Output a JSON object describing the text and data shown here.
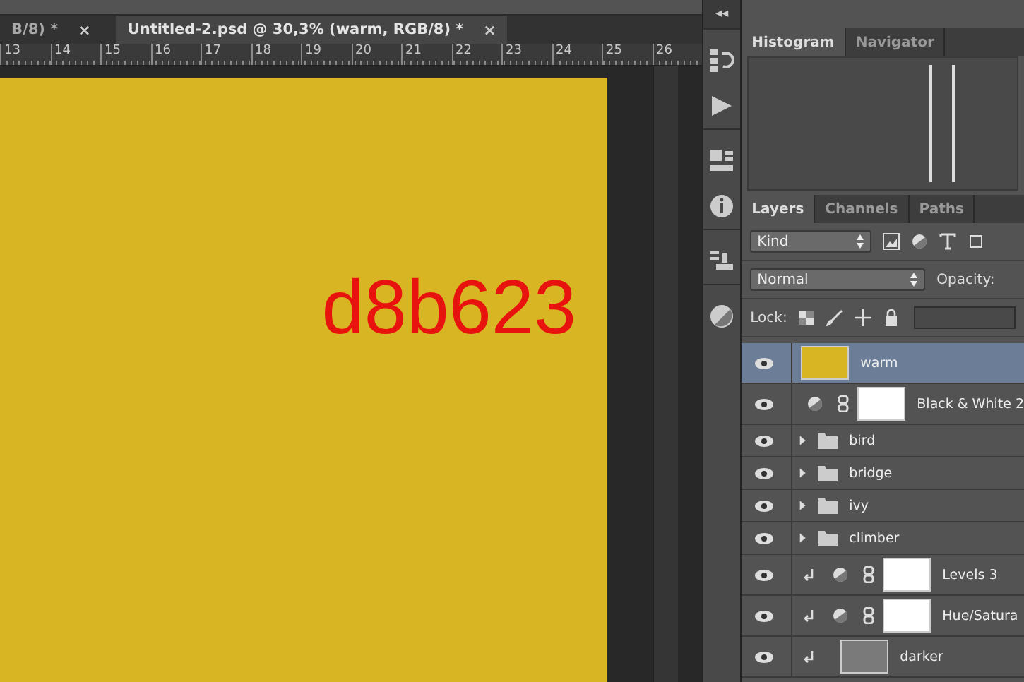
{
  "tabs": [
    {
      "label": "B/8) *",
      "close": "×",
      "selected": false
    },
    {
      "label": "Untitled-2.psd @ 30,3% (warm, RGB/8) *",
      "close": "×",
      "selected": true
    }
  ],
  "ruler": [
    "13",
    "14",
    "15",
    "16",
    "17",
    "18",
    "19",
    "20",
    "21",
    "22",
    "23",
    "24",
    "25",
    "26"
  ],
  "canvas": {
    "color": "#d8b623",
    "text": "d8b623"
  },
  "dock": {
    "collapse": "◂◂"
  },
  "top_panel": {
    "tabs": [
      {
        "label": "Histogram",
        "selected": true
      },
      {
        "label": "Navigator",
        "selected": false
      }
    ]
  },
  "layers_panel": {
    "tabs": [
      {
        "label": "Layers",
        "selected": true
      },
      {
        "label": "Channels",
        "selected": false
      },
      {
        "label": "Paths",
        "selected": false
      }
    ],
    "filter": "Kind",
    "blend_mode": "Normal",
    "opacity_label": "Opacity:",
    "lock_label": "Lock:",
    "layers": [
      {
        "kind": "fill",
        "name": "warm",
        "selected": true,
        "clipped": false,
        "color": "#d8b623"
      },
      {
        "kind": "adjustment",
        "name": "Black & White 2",
        "selected": false,
        "clipped": false
      },
      {
        "kind": "group",
        "name": "bird",
        "selected": false,
        "clipped": false
      },
      {
        "kind": "group",
        "name": "bridge",
        "selected": false,
        "clipped": false
      },
      {
        "kind": "group",
        "name": "ivy",
        "selected": false,
        "clipped": false
      },
      {
        "kind": "group",
        "name": "climber",
        "selected": false,
        "clipped": false
      },
      {
        "kind": "adjustment",
        "name": "Levels 3",
        "selected": false,
        "clipped": true
      },
      {
        "kind": "adjustment",
        "name": "Hue/Satura",
        "selected": false,
        "clipped": true
      },
      {
        "kind": "smart",
        "name": "darker",
        "selected": false,
        "clipped": true
      }
    ]
  }
}
